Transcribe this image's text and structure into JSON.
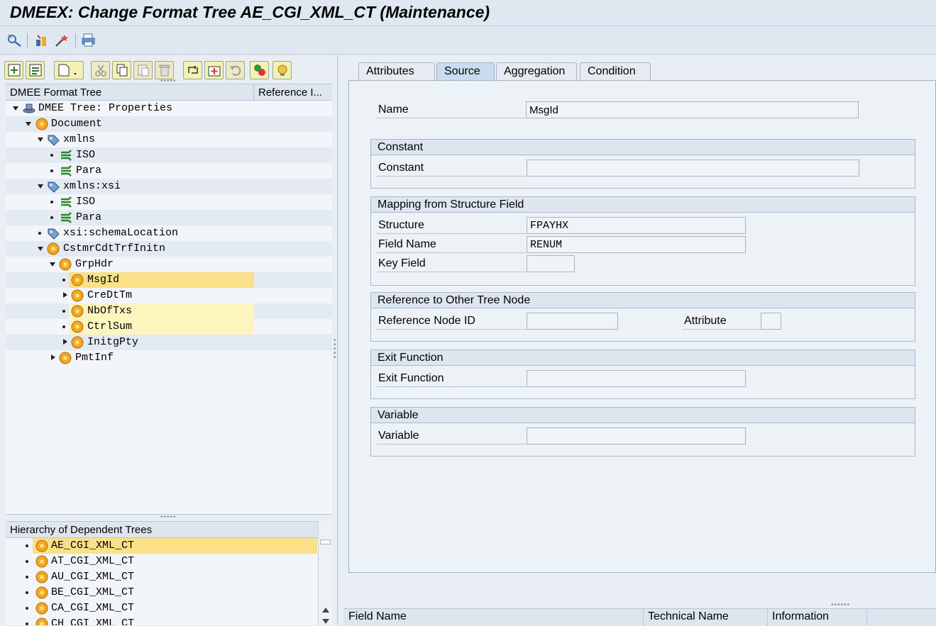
{
  "window": {
    "title": "DMEEX: Change Format Tree AE_CGI_XML_CT (Maintenance)"
  },
  "app_toolbar": {
    "icons": [
      "display-change-icon",
      "object-list-icon",
      "wizard-icon",
      "print-icon"
    ]
  },
  "tree_toolbar": {
    "icons": [
      "insert-node-icon",
      "insert-subnode-icon",
      "new-document-dropdown-icon",
      "cut-icon",
      "copy-icon",
      "paste-icon",
      "delete-icon",
      "move-node-icon",
      "add-element-icon",
      "undo-icon",
      "check-icon",
      "info-bulb-icon"
    ]
  },
  "format_tree": {
    "header": {
      "col1": "DMEE Format Tree",
      "col2": "Reference I..."
    },
    "nodes": [
      {
        "label": "DMEE Tree: Properties",
        "icon": "tree-properties-icon"
      },
      {
        "label": "Document",
        "icon": "element-node-icon"
      },
      {
        "label": "xmlns",
        "icon": "attribute-tag-icon"
      },
      {
        "label": "ISO",
        "icon": "mapping-node-icon"
      },
      {
        "label": "Para",
        "icon": "mapping-node-icon"
      },
      {
        "label": "xmlns:xsi",
        "icon": "attribute-tag-icon"
      },
      {
        "label": "ISO",
        "icon": "mapping-node-icon"
      },
      {
        "label": "Para",
        "icon": "mapping-node-icon"
      },
      {
        "label": "xsi:schemaLocation",
        "icon": "attribute-tag-icon"
      },
      {
        "label": "CstmrCdtTrfInitn",
        "icon": "element-node-icon"
      },
      {
        "label": "GrpHdr",
        "icon": "element-node-icon"
      },
      {
        "label": "MsgId",
        "icon": "element-node-icon"
      },
      {
        "label": "CreDtTm",
        "icon": "element-node-icon"
      },
      {
        "label": "NbOfTxs",
        "icon": "element-node-icon"
      },
      {
        "label": "CtrlSum",
        "icon": "element-node-icon"
      },
      {
        "label": "InitgPty",
        "icon": "element-node-icon"
      },
      {
        "label": "PmtInf",
        "icon": "element-node-icon"
      }
    ]
  },
  "dependent_trees": {
    "header": "Hierarchy of Dependent Trees",
    "items": [
      "AE_CGI_XML_CT",
      "AT_CGI_XML_CT",
      "AU_CGI_XML_CT",
      "BE_CGI_XML_CT",
      "CA_CGI_XML_CT",
      "CH_CGI_XML_CT"
    ]
  },
  "tabs": [
    "Attributes",
    "Source",
    "Aggregation",
    "Condition"
  ],
  "source": {
    "name_label": "Name",
    "name_value": "MsgId",
    "constant": {
      "title": "Constant",
      "label": "Constant",
      "value": ""
    },
    "mapping": {
      "title": "Mapping from Structure Field",
      "structure_label": "Structure",
      "structure_value": "FPAYHX",
      "field_label": "Field Name",
      "field_value": "RENUM",
      "key_label": "Key Field",
      "key_value": ""
    },
    "reference": {
      "title": "Reference to Other Tree Node",
      "node_label": "Reference Node ID",
      "node_value": "",
      "attr_label": "Attribute",
      "attr_value": ""
    },
    "exit_function": {
      "title": "Exit Function",
      "label": "Exit Function",
      "value": ""
    },
    "variable": {
      "title": "Variable",
      "label": "Variable",
      "value": ""
    }
  },
  "bottom_grid": {
    "columns": [
      "Field Name",
      "Technical Name",
      "Information"
    ]
  },
  "colors": {
    "highlight": "#fbe08a",
    "highlight_light": "#fcf5be",
    "node_orange": "#f5a623"
  }
}
